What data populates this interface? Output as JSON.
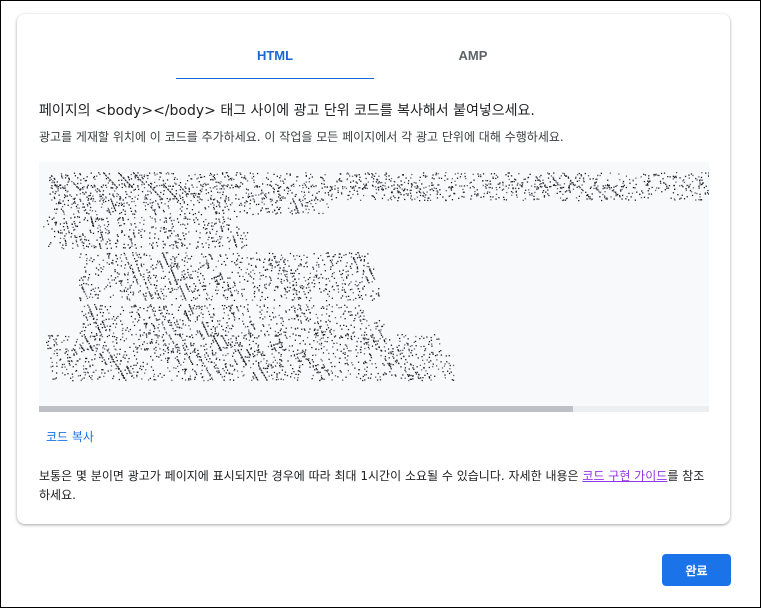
{
  "tabs": [
    {
      "label": "HTML",
      "selected": true
    },
    {
      "label": "AMP",
      "selected": false
    }
  ],
  "instructions": {
    "prefix": "페이지의 ",
    "tag": "<body></body>",
    "suffix": " 태그 사이에 광고 단위 코드를 복사해서 붙여넣으세요.",
    "sub": "광고를 게재할 위치에 이 코드를 추가하세요. 이 작업을 모든 페이지에서 각 광고 단위에 대해 수행하세요."
  },
  "code_box": {
    "content": "obscured"
  },
  "copy_label": "코드 복사",
  "note": {
    "text": "보통은 몇 분이면 광고가 페이지에 표시되지만 경우에 따라 최대 1시간이 소요될 수 있습니다. 자세한 내용은 ",
    "link": "코드 구현 가이드",
    "suffix": "를 참조하세요."
  },
  "done_label": "완료",
  "colors": {
    "accent": "#1a73e8",
    "link_visited": "#9334e6",
    "tab_inactive": "#5f6368"
  }
}
